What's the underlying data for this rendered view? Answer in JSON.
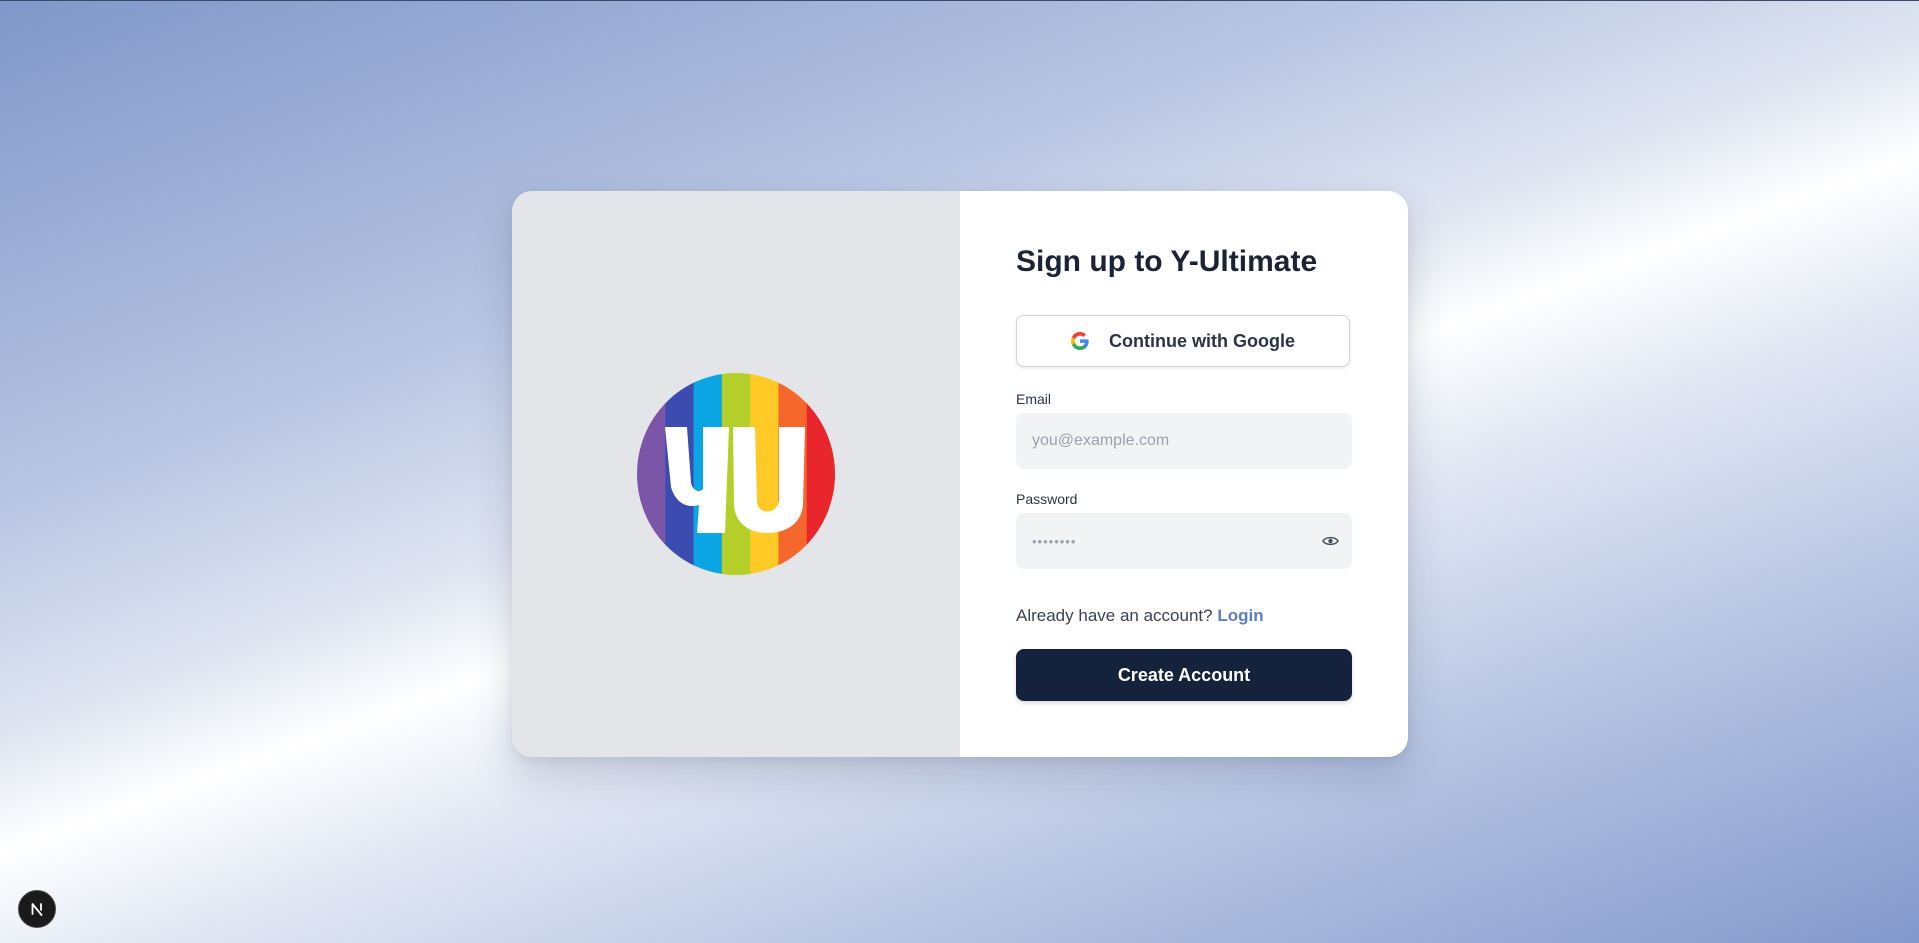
{
  "page": {
    "title": "Sign up to Y-Ultimate"
  },
  "google_button": {
    "label": "Continue with Google",
    "icon": "google-icon"
  },
  "email": {
    "label": "Email",
    "placeholder": "you@example.com",
    "value": ""
  },
  "password": {
    "label": "Password",
    "placeholder": "••••••••",
    "value": "",
    "toggle_icon": "eye-icon"
  },
  "account_prompt": {
    "text": "Already have an account?",
    "link_label": "Login"
  },
  "submit_button": {
    "label": "Create Account"
  },
  "logo": {
    "text": "YU",
    "stripe_colors": [
      "#7a55a8",
      "#3c4bb0",
      "#0aa5e2",
      "#b5cf2a",
      "#ffc926",
      "#f5672a",
      "#e8262b"
    ]
  },
  "dev_badge": {
    "letter": "N"
  },
  "colors": {
    "primary": "#15223c",
    "link": "#5b7fc0",
    "left_panel": "#e4e5e9"
  }
}
